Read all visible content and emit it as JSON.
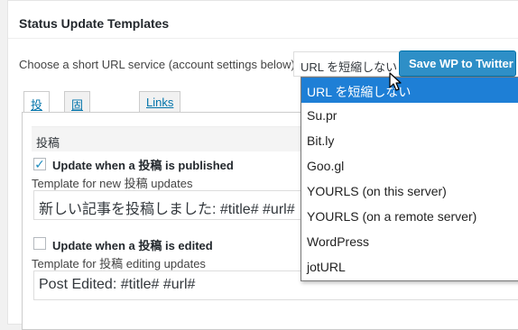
{
  "header": {
    "title": "Status Update Templates"
  },
  "url_service": {
    "label": "Choose a short URL service (account settings below)",
    "selected": "URL を短縮しない",
    "options": [
      "URL を短縮しない",
      "Su.pr",
      "Bit.ly",
      "Goo.gl",
      "YOURLS (on this server)",
      "YOURLS (on a remote server)",
      "WordPress",
      "jotURL"
    ],
    "save_label": "Save WP to Twitter"
  },
  "tabs": [
    {
      "label": "投稿"
    },
    {
      "label": "固定ページ"
    },
    {
      "label": "Links"
    }
  ],
  "post_section": {
    "heading": "投稿",
    "publish": {
      "checked": true,
      "label": "Update when a 投稿 is published",
      "hint": "Template for new 投稿 updates",
      "value": "新しい記事を投稿しました: #title# #url#"
    },
    "edit": {
      "checked": false,
      "label": "Update when a 投稿 is edited",
      "hint": "Template for 投稿 editing updates",
      "value": "Post Edited: #title# #url#"
    }
  },
  "colors": {
    "accent": "#0073aa",
    "button": "#2e8fc7",
    "highlight": "#1e7fd6"
  },
  "icons": {
    "checkmark": "check-icon",
    "pointer": "mouse-cursor-icon"
  }
}
